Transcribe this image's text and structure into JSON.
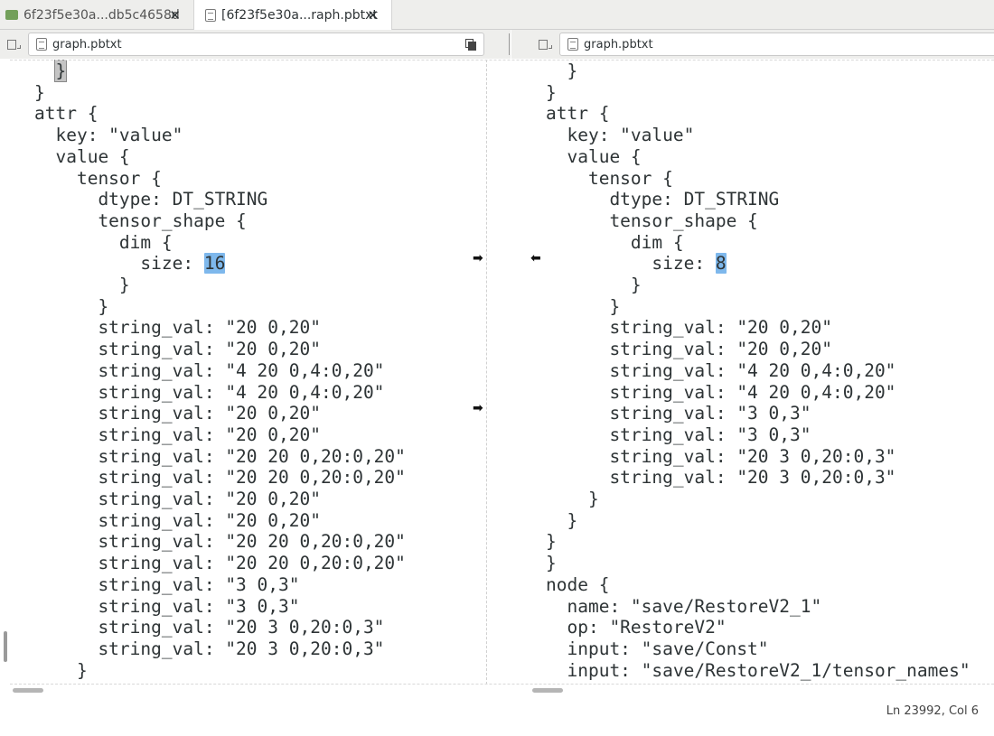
{
  "tabs": [
    {
      "label": "6f23f5e30a...db5c4658d",
      "icon": "folder-icon",
      "close": "✕",
      "active": false
    },
    {
      "label": "[6f23f5e30a...raph.pbtxt",
      "icon": "document-icon",
      "close": "✕",
      "active": true
    }
  ],
  "left_file": {
    "name": "graph.pbtxt"
  },
  "right_file": {
    "name": "graph.pbtxt"
  },
  "left_lines": [
    "  }",
    "}",
    "attr {",
    "  key: \"value\"",
    "  value {",
    "    tensor {",
    "      dtype: DT_STRING",
    "      tensor_shape {",
    "        dim {",
    "          size: 16",
    "        }",
    "      }",
    "      string_val: \"20 0,20\"",
    "      string_val: \"20 0,20\"",
    "      string_val: \"4 20 0,4:0,20\"",
    "      string_val: \"4 20 0,4:0,20\"",
    "      string_val: \"20 0,20\"",
    "      string_val: \"20 0,20\"",
    "      string_val: \"20 20 0,20:0,20\"",
    "      string_val: \"20 20 0,20:0,20\"",
    "      string_val: \"20 0,20\"",
    "      string_val: \"20 0,20\"",
    "      string_val: \"20 20 0,20:0,20\"",
    "      string_val: \"20 20 0,20:0,20\"",
    "      string_val: \"3 0,3\"",
    "      string_val: \"3 0,3\"",
    "      string_val: \"20 3 0,20:0,3\"",
    "      string_val: \"20 3 0,20:0,3\"",
    "    }"
  ],
  "right_lines": [
    "  }",
    "}",
    "attr {",
    "  key: \"value\"",
    "  value {",
    "    tensor {",
    "      dtype: DT_STRING",
    "      tensor_shape {",
    "        dim {",
    "          size: 8",
    "        }",
    "      }",
    "      string_val: \"20 0,20\"",
    "      string_val: \"20 0,20\"",
    "      string_val: \"4 20 0,4:0,20\"",
    "      string_val: \"4 20 0,4:0,20\"",
    "      string_val: \"3 0,3\"",
    "      string_val: \"3 0,3\"",
    "      string_val: \"20 3 0,20:0,3\"",
    "      string_val: \"20 3 0,20:0,3\"",
    "    }",
    "  }",
    "}",
    "}",
    "node {",
    "  name: \"save/RestoreV2_1\"",
    "  op: \"RestoreV2\"",
    "  input: \"save/Const\"",
    "  input: \"save/RestoreV2_1/tensor_names\""
  ],
  "highlight": {
    "left_value": "16",
    "right_value": "8"
  },
  "arrows": {
    "copy_right": "➡",
    "copy_left": "⬅"
  },
  "status": {
    "position": "Ln 23992, Col 6"
  },
  "colors": {
    "changed_line": "#b8dcfc",
    "inserted_block": "#c8f5a0",
    "token_highlight": "#7eb8ec"
  }
}
